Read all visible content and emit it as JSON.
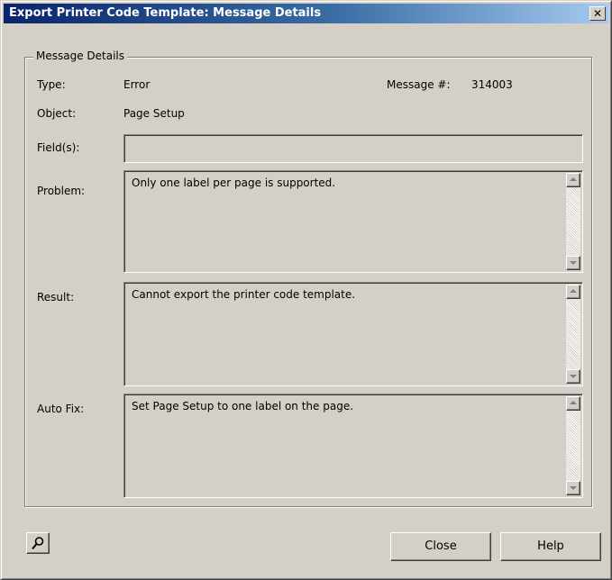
{
  "window": {
    "title": "Export Printer Code Template: Message Details",
    "close_glyph": "✕"
  },
  "details": {
    "group_label": "Message Details",
    "type_label": "Type:",
    "type_value": "Error",
    "message_num_label": "Message #:",
    "message_num_value": "314003",
    "object_label": "Object:",
    "object_value": "Page Setup",
    "fields_label": "Field(s):",
    "fields_value": "",
    "problem_label": "Problem:",
    "problem_value": "Only one label per page is supported.",
    "result_label": "Result:",
    "result_value": "Cannot export the printer code template.",
    "autofix_label": "Auto Fix:",
    "autofix_value": "Set Page Setup to one label on the page."
  },
  "buttons": {
    "close": "Close",
    "help": "Help"
  },
  "icons": {
    "title_close": "close-icon",
    "footer_tool": "search-icon"
  }
}
